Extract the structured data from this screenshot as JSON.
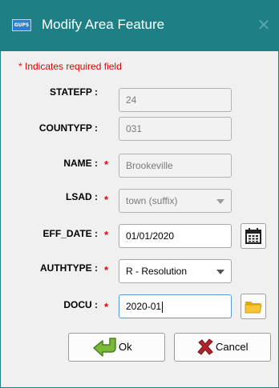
{
  "window": {
    "title": "Modify Area Feature",
    "app_icon_text": "GUPS",
    "close_glyph": "✕"
  },
  "form": {
    "required_note": "* Indicates required field",
    "required_marker": "*",
    "fields": {
      "statefp": {
        "label": "STATEFP :",
        "value": "24",
        "required": false,
        "enabled": false
      },
      "countyfp": {
        "label": "COUNTYFP :",
        "value": "031",
        "required": false,
        "enabled": false
      },
      "name": {
        "label": "NAME :",
        "value": "Brookeville",
        "required": true,
        "enabled": false
      },
      "lsad": {
        "label": "LSAD :",
        "value": "town (suffix)",
        "required": true,
        "enabled": false,
        "type": "select"
      },
      "eff_date": {
        "label": "EFF_DATE :",
        "value": "01/01/2020",
        "required": true,
        "enabled": true,
        "icon": "calendar-icon"
      },
      "authtype": {
        "label": "AUTHTYPE :",
        "value": "R - Resolution",
        "required": true,
        "enabled": true,
        "type": "select"
      },
      "docu": {
        "label": "DOCU :",
        "value": "2020-01",
        "required": true,
        "enabled": true,
        "focused": true,
        "icon": "folder-icon"
      }
    }
  },
  "buttons": {
    "ok": {
      "label": "Ok",
      "icon": "ok-arrow-icon"
    },
    "cancel": {
      "label": "Cancel",
      "icon": "cancel-x-icon"
    }
  },
  "colors": {
    "titlebar": "#1e7f84",
    "required": "#e30000",
    "focus_border": "#5b9bd5"
  }
}
